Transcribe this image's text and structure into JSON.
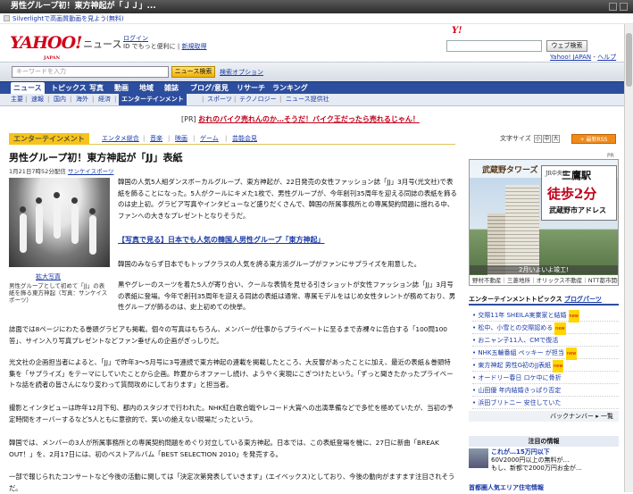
{
  "window": {
    "title": "男性グループ初！東方神起が「ＪＪ」..."
  },
  "silverlight_bar": {
    "text": "Silverlightで高画質動画を見よう(無料)"
  },
  "header": {
    "logo_text": "YAHOO!",
    "logo_sub": "JAPAN",
    "service_name": "ニュース",
    "login_link": "ログイン",
    "login_sub": "ID でもっと便利に",
    "register_link": "新規取得",
    "search_button": "ウェブ検索",
    "yj_logo": "Y!",
    "links": [
      "Yahoo! JAPAN",
      "ヘルプ"
    ]
  },
  "search": {
    "placeholder": "キーワードを入力",
    "button": "ニュース検索",
    "advanced": "検索オプション"
  },
  "nav_primary": [
    "ニュース",
    "トピックス",
    "写真",
    "動画",
    "地域",
    "雑誌",
    "ブログ/意見",
    "リサーチ",
    "ランキング"
  ],
  "nav_secondary": [
    "主要",
    "速報",
    "国内",
    "海外",
    "経済",
    "エンターテインメント",
    "スポーツ",
    "テクノロジー",
    "ニュース提供社"
  ],
  "pr": {
    "label": "[PR]",
    "text": "おれのバイク売れんのか…そうだ！バイク王だったら売れるじゃん！"
  },
  "category_tabs": {
    "active": "エンターテインメント",
    "items": [
      "エンタメ総合",
      "音楽",
      "映画",
      "ゲーム",
      "芸能会見"
    ]
  },
  "text_size_label": "文字サイズ",
  "text_size_buttons": [
    "小",
    "中",
    "大"
  ],
  "rss_label": "+ 最新RSS",
  "article": {
    "title": "男性グループ初！東方神起が「JJ」表紙",
    "date": "1月21日7時52分配信",
    "source": "サンケイスポーツ",
    "enlarge": "拡大写真",
    "caption": "男性グループとして初めて「JJ」の表紙を飾る東方神起（写真：サンケイスポーツ）",
    "p1": "韓国の人気5人組ダンスボーカルグループ、東方神起が、22日発売の女性ファッション誌「JJ」3月号(光文社)で表紙を飾ることになった。5人がクールにキメた1枚で、男性グループが、今年創刊35周年を迎える同誌の表紙を飾るのは史上初。グラビア写真やインタビューなど盛りだくさんで、韓国の所属事務所との専属契約問題に揺れる中、ファンへの大きなプレゼントとなりそうだ。",
    "link": "【写真で見る】日本でも人気の韓国人男性グループ「東方神起」",
    "p2": "韓国のみならず日本でもトップクラスの人気を誇る東方派グループがファンにサプライズを用意した。",
    "p3": "黒やグレーのスーツを着た5人が寄り合い、クールな表情を見せる引きショットが女性ファッション誌「JJ」3月号の表紙に登場。今年で創刊35周年を迎える同誌の表紙は通常、専属モデルをはじめ女性タレントが務めており、男性グループが飾るのは、史上初めての快挙。",
    "p4": "誌面では8ページにわたる巻頭グラビアも掲載。個々の写真はもちろん、メンバーが仕事からプライベートに至るまで赤裸々に告白する「100問100答」、サイン入り写真プレゼントなどファン垂ぜんの企画がぎっしりだ。",
    "p5": "光文社の企画担当者によると、「JJ」で昨年3～5月号に3号連続で東方神起の連載を掲載したところ、大反響があったことに加え、最近の表紙＆巻頭特集を「サプライズ」をテーマにしていたことから企画。昨夏からオファーし続け、ようやく実現にこぎつけたという。「ずっと聞きたかったプライベートな話を読者の皆さんになり変わって質問攻めにしております」と担当者。",
    "p6": "撮影とインタビューは昨年12月下旬、都内のスタジオで行われた。NHK紅白歌合戦やレコード大賞への出演準備などで多忙を極めていたが、当初の予定時間をオーバーするなど5人ともに意欲的で、笑いの絶えない現場だったという。",
    "p7": "韓国では、メンバーの3人が所属事務所との専属契約問題をめぐり対立している東方神起。日本では、この表紙登場を機に、27日に新曲「BREAK OUT！」を、2月17日には、初のベストアルバム「BEST SELECTION 2010」を発売する。",
    "p8": "一部で報じられたコンサートなど今後の活動に関しては「決定次第発表していきます」(エイベックス)としており、今後の動向がますます注目されそうだ。"
  },
  "ad": {
    "label": "PR",
    "brand": "武蔵野タワーズ",
    "line1": "JR中央線",
    "station": "三鷹駅",
    "walk": "徒歩2分",
    "address": "武蔵野市アドレス",
    "bottom1": "2月いよいよ竣工!",
    "bottom2": "野村不動産｜三菱地所｜オリックス不動産｜NTT都市開発"
  },
  "ent_topics": {
    "title": "エンターテインメントトピックス",
    "blog_link": "ブログパーツ",
    "items": [
      "交際11年 SHEILA実業家と結婚",
      "松中、小雪との交際認める",
      "おニャン子11人、CMで復活",
      "NHK五輪番組 ペッキー が担当",
      "東方神起 男性G初のJJ表紙",
      "オードリー春日 ロケ中に骨折",
      "山田優 年内結婚きっぱり否定",
      "浜田ブリトニー 安住していた"
    ],
    "new_label": "new",
    "backnumber": "バックナンバー ▸ 一覧"
  },
  "featured": {
    "title": "注目の情報",
    "item1_title": "これが…15万円以下",
    "item1_text": "60V2000円以上の無料が…",
    "item1_extra": "もし、新都で2000万円お金が…",
    "item2_title": "首都圏人気エリア住宅情報"
  }
}
